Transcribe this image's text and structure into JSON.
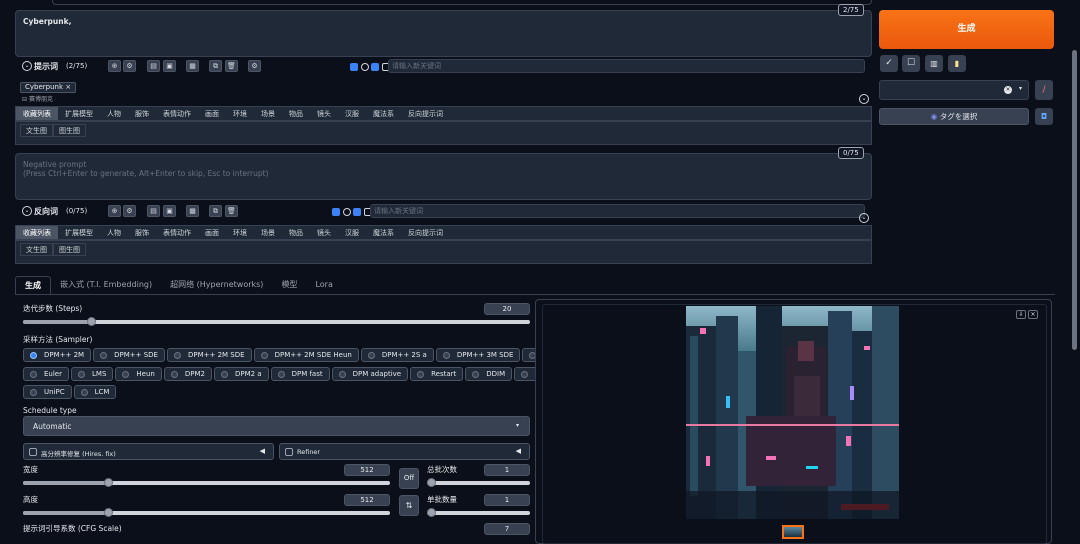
{
  "prompt": {
    "text": "Cyberpunk,",
    "counter": "2/75",
    "label": "提示词",
    "label_count": "(2/75)",
    "keyword_placeholder": "请输入新关键词",
    "tag_chip": "Cyberpunk",
    "tag_translation": "赛博朋克"
  },
  "negative": {
    "placeholder_line1": "Negative prompt",
    "placeholder_line2": "(Press Ctrl+Enter to generate, Alt+Enter to skip, Esc to interrupt)",
    "counter": "0/75",
    "label": "反向词",
    "label_count": "(0/75)",
    "keyword_placeholder": "请输入新关键词"
  },
  "category_tabs": [
    "收藏列表",
    "扩展模型",
    "人物",
    "服饰",
    "表情动作",
    "画面",
    "环境",
    "场景",
    "物品",
    "镜头",
    "汉服",
    "魔法系",
    "反向提示词"
  ],
  "sub_tabs": [
    "文生图",
    "图生图"
  ],
  "right": {
    "generate_label": "生成",
    "tag_select_label": "タグを選択",
    "tool_icons": [
      "check-icon",
      "square-icon",
      "trash-icon",
      "clipboard-icon"
    ]
  },
  "main_tabs": [
    "生成",
    "嵌入式 (T.I. Embedding)",
    "超网络 (Hypernetworks)",
    "模型",
    "Lora"
  ],
  "steps": {
    "label": "迭代步数 (Steps)",
    "value": "20",
    "min": 1,
    "max": 150
  },
  "sampler": {
    "label": "采样方法 (Sampler)",
    "selected": "DPM++ 2M",
    "options_row1": [
      "DPM++ 2M",
      "DPM++ SDE",
      "DPM++ 2M SDE",
      "DPM++ 2M SDE Heun",
      "DPM++ 2S a",
      "DPM++ 3M SDE",
      "Euler a"
    ],
    "options_row2": [
      "Euler",
      "LMS",
      "Heun",
      "DPM2",
      "DPM2 a",
      "DPM fast",
      "DPM adaptive",
      "Restart",
      "DDIM",
      "PLMS"
    ],
    "options_row3": [
      "UniPC",
      "LCM"
    ]
  },
  "schedule": {
    "label": "Schedule type",
    "value": "Automatic"
  },
  "hires": {
    "label": "高分辨率修复 (Hires. fix)"
  },
  "refiner": {
    "label": "Refiner"
  },
  "width": {
    "label": "宽度",
    "value": "512",
    "level": 0.2
  },
  "height": {
    "label": "高度",
    "value": "512",
    "level": 0.2
  },
  "batch_count": {
    "label": "总批次数",
    "value": "1",
    "level": 0.0
  },
  "batch_size": {
    "label": "单批数量",
    "value": "1",
    "level": 0.0
  },
  "cfg": {
    "label": "提示词引导系数 (CFG Scale)",
    "value": "7"
  },
  "off_label": "Off",
  "swap_icon": "swap-icon",
  "colors": {
    "accent_orange": "#ea580c",
    "bg": "#0b0f19",
    "panel": "#1f2937",
    "selected": "#3b82f6"
  }
}
